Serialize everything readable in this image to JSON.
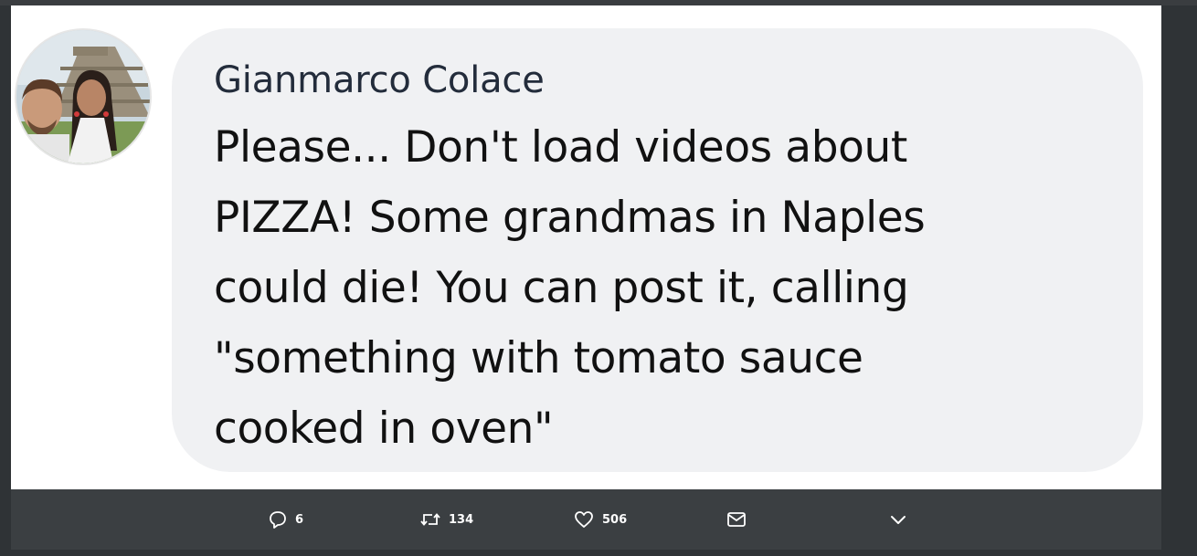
{
  "comment": {
    "author": "Gianmarco Colace",
    "text": "Please... Don't load videos about\nPIZZA! Some grandmas in Naples\ncould die! You can post it, calling\n\"something with tomato sauce\ncooked in oven\""
  },
  "actions": {
    "reply_count": "6",
    "retweet_count": "134",
    "like_count": "506"
  },
  "colors": {
    "bubble": "#f0f1f3",
    "action_bar": "#3b3f42",
    "author_text": "#232c3b"
  },
  "icons": [
    "speech-bubble-icon",
    "retweet-icon",
    "heart-icon",
    "envelope-icon",
    "chevron-down-icon"
  ]
}
